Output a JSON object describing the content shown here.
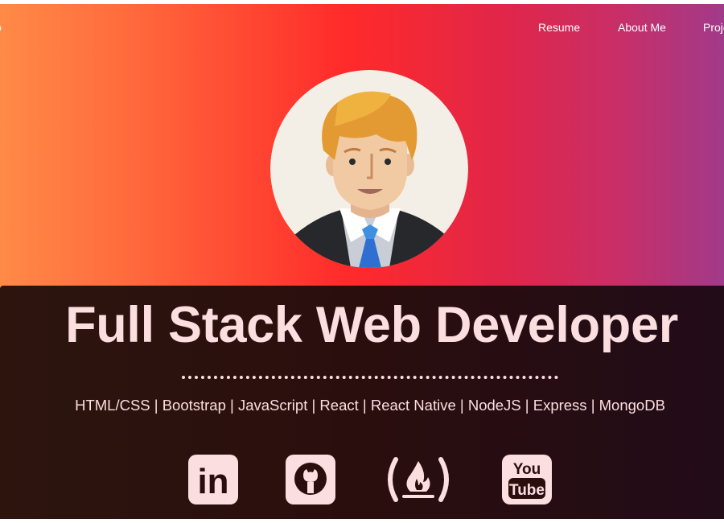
{
  "nav": {
    "brand_text": "o",
    "links": [
      {
        "label": "Resume"
      },
      {
        "label": "About Me"
      },
      {
        "label": "Proje"
      }
    ]
  },
  "hero": {
    "title": "Full Stack Web Developer",
    "skills": "HTML/CSS | Bootstrap | JavaScript | React | React Native | NodeJS | Express | MongoDB"
  },
  "social": [
    {
      "icon": "linkedin-icon",
      "text": "in"
    },
    {
      "icon": "github-icon"
    },
    {
      "icon": "freecodecamp-icon"
    },
    {
      "icon": "youtube-icon",
      "text_top": "You",
      "text_bottom": "Tube"
    }
  ],
  "colors": {
    "gradient": [
      "#ff8a47",
      "#ff2a2a",
      "#a23a8a"
    ],
    "panel": "#2a0e0e",
    "text": "#fbdedf",
    "avatar_bg": "#f4efe6"
  }
}
